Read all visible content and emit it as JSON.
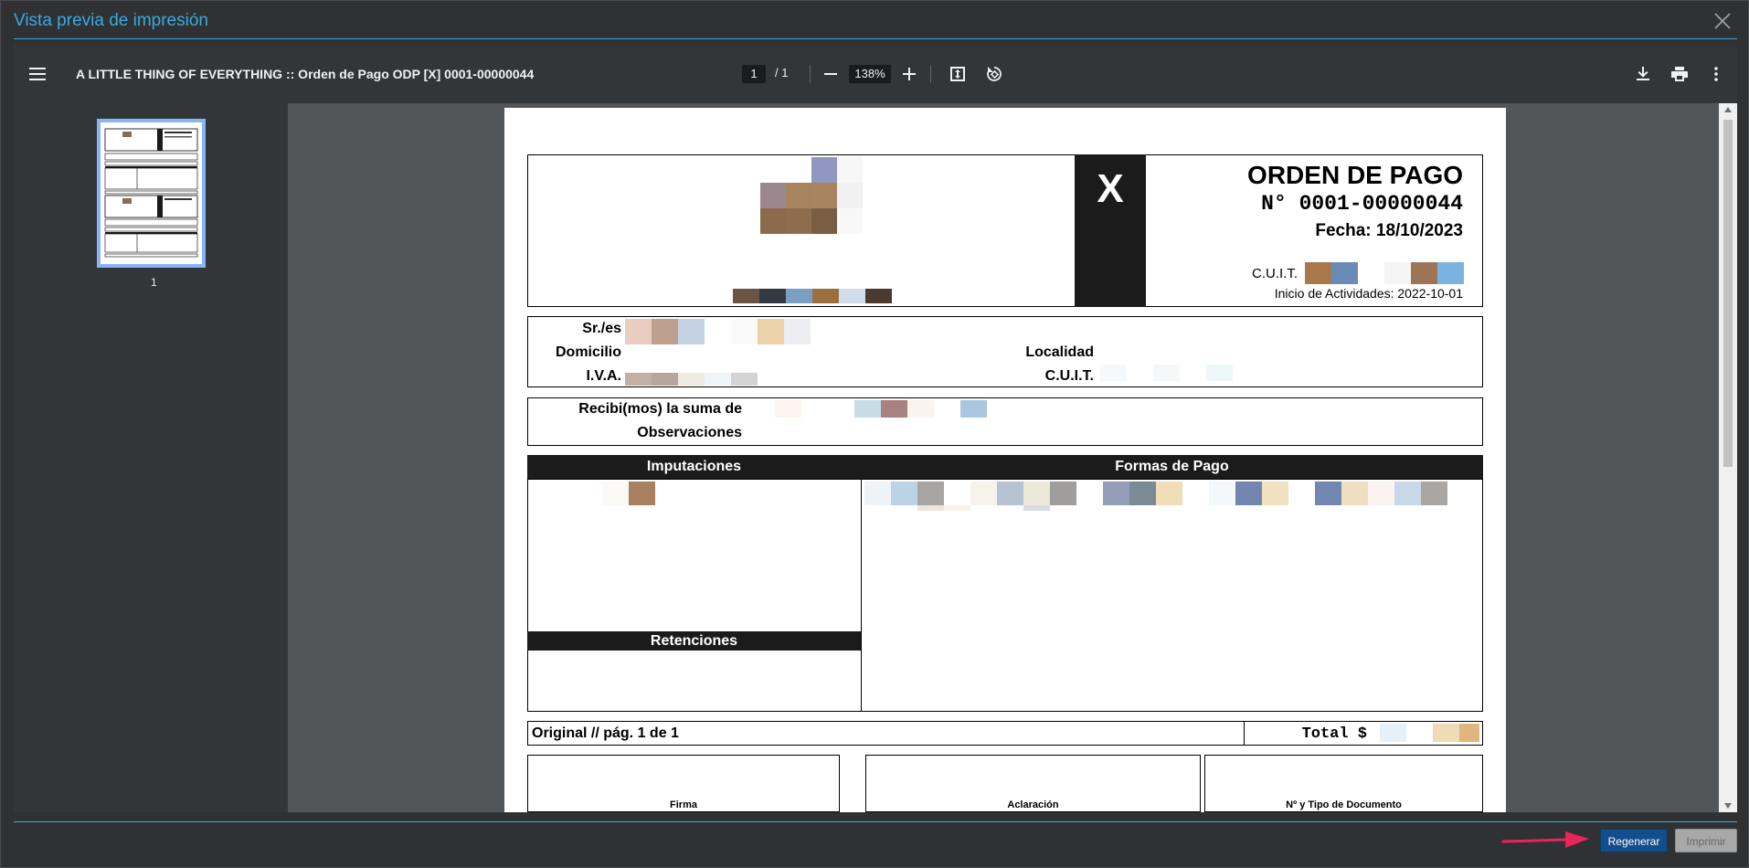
{
  "window": {
    "title": "Vista previa de impresión"
  },
  "viewer": {
    "doc_title": "A LITTLE THING OF EVERYTHING :: Orden de Pago ODP [X] 0001-00000044",
    "page_current": "1",
    "page_separator": "/ 1",
    "zoom": "138%",
    "thumbnail_label": "1"
  },
  "document": {
    "letter": "X",
    "heading": "ORDEN DE PAGO",
    "number": "N° 0001-00000044",
    "date": "Fecha: 18/10/2023",
    "cuit_label": "C.U.I.T.",
    "start_activities": "Inicio de Actividades: 2022-10-01",
    "client": {
      "sres_label": "Sr./es",
      "domicilio_label": "Domicilio",
      "localidad_label": "Localidad",
      "iva_label": "I.V.A.",
      "cuit_label": "C.U.I.T."
    },
    "received_label": "Recibi(mos) la suma de",
    "observations_label": "Observaciones",
    "imputaciones_header": "Imputaciones",
    "formas_header": "Formas de Pago",
    "retenciones_header": "Retenciones",
    "original_label": "Original // pág. 1 de 1",
    "total_label": "Total $",
    "signature": {
      "firma": "Firma",
      "aclaracion": "Aclaración",
      "documento": "Nº y Tipo de Documento"
    }
  },
  "footer": {
    "regenerate_label": "Regenerar",
    "print_label": "Imprimir"
  },
  "colors": {
    "accent": "#3aa9e0",
    "regen_button": "#134d8b",
    "arrow": "#e8245a"
  }
}
